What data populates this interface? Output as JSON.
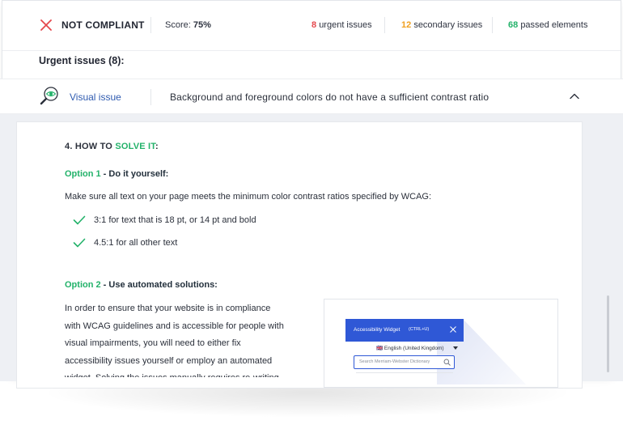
{
  "header": {
    "status": "NOT COMPLIANT",
    "score_label": "Score:",
    "score_value": "75%",
    "urgent_count": "8",
    "urgent_label": "urgent issues",
    "secondary_count": "12",
    "secondary_label": "secondary issues",
    "passed_count": "68",
    "passed_label": "passed elements"
  },
  "urgent_section": {
    "title": "Urgent issues (8):"
  },
  "issue": {
    "type": "Visual issue",
    "description": "Background and foreground colors do not have a sufficient contrast ratio"
  },
  "solution": {
    "heading_prefix": "4. HOW TO ",
    "heading_highlight": "SOLVE IT",
    "heading_suffix": ":",
    "option1_label": "Option 1",
    "option1_title": " - Do it yourself:",
    "option1_text": "Make sure all text on your page meets the minimum color contrast ratios specified by WCAG:",
    "checks": [
      "3:1 for text that is 18 pt, or 14 pt and bold",
      "4.5:1 for all other text"
    ],
    "option2_label": "Option 2",
    "option2_title": " - Use automated solutions:",
    "option2_lines": [
      "In order to ensure that your website is in compliance",
      "with WCAG guidelines and is accessible for people with",
      "visual impairments, you will need to either fix",
      "accessibility issues yourself or employ an automated",
      "widget. Solving the issues manually requires re-writing"
    ]
  },
  "widget": {
    "title": "Accessibility Widget",
    "shortcut": "(CTRL+U)",
    "language": "🇬🇧 English (United Kingdom)",
    "search_placeholder": "Search Merriam-Webster Dictionary"
  },
  "colors": {
    "red": "#e5484d",
    "orange": "#f0a020",
    "green": "#23b26a",
    "blue": "#2f58d6"
  },
  "icons": [
    "close-x-icon",
    "magnifier-eye-icon",
    "chevron-up-icon",
    "check-icon",
    "search-icon"
  ]
}
